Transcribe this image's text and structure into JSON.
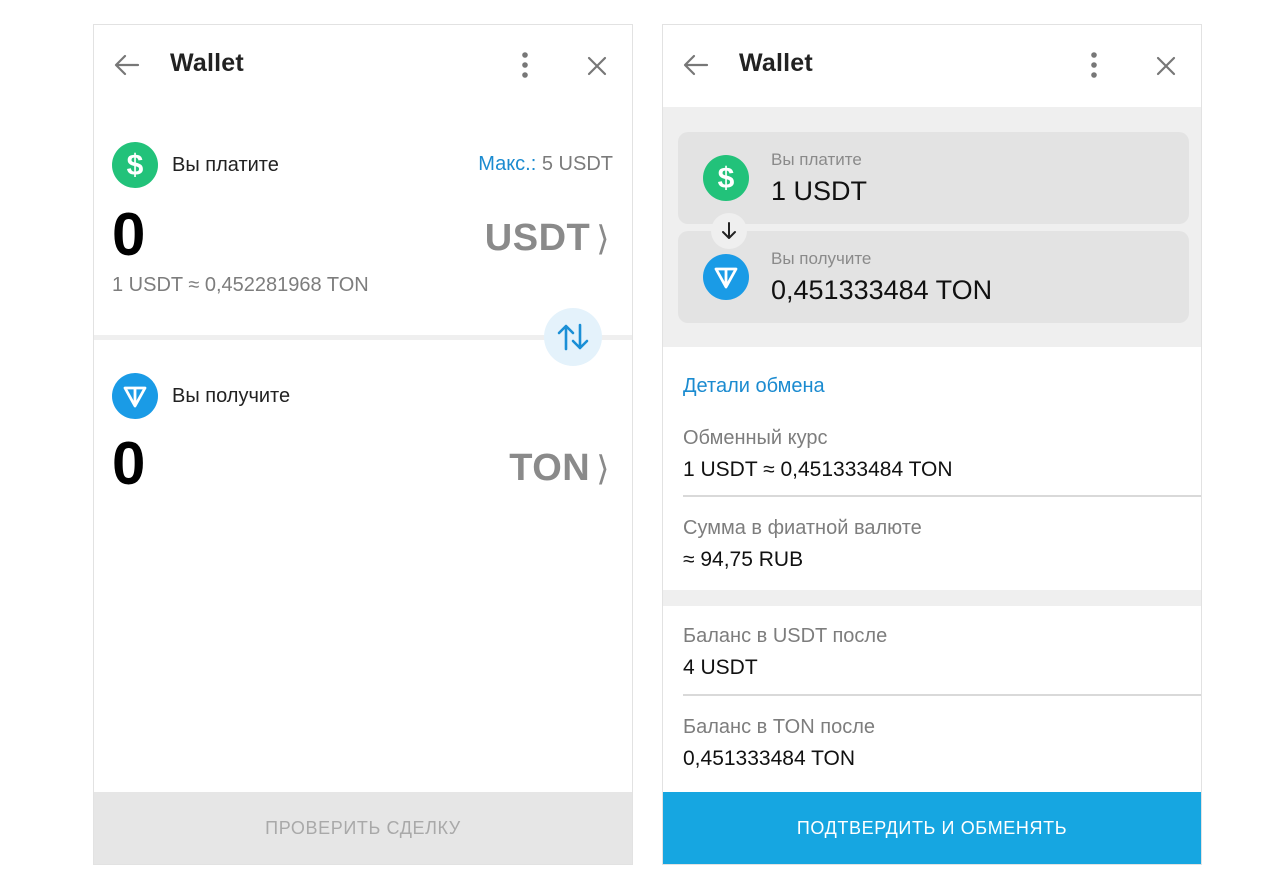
{
  "colors": {
    "accent": "#1b8bd0",
    "primary_button": "#16a6e1",
    "usdt": "#22c27a",
    "ton": "#1a9be6"
  },
  "left": {
    "header": {
      "title": "Wallet",
      "back_icon": "arrow-left-icon",
      "menu_icon": "more-vertical-icon",
      "close_icon": "close-icon"
    },
    "pay": {
      "label": "Вы платите",
      "max_key": "Макс.:",
      "max_value": " 5 USDT",
      "amount": "0",
      "currency": "USDT",
      "rate": "1 USDT ≈ 0,452281968 TON"
    },
    "receive": {
      "label": "Вы получите",
      "amount": "0",
      "currency": "TON"
    },
    "chevron": "⟩",
    "footer_button": "ПРОВЕРИТЬ СДЕЛКУ"
  },
  "right": {
    "header": {
      "title": "Wallet",
      "back_icon": "arrow-left-icon",
      "menu_icon": "more-vertical-icon",
      "close_icon": "close-icon"
    },
    "pay": {
      "label": "Вы платите",
      "value": "1 USDT"
    },
    "receive": {
      "label": "Вы получите",
      "value": "0,451333484 TON"
    },
    "details_title": "Детали обмена",
    "details": [
      {
        "label": "Обменный курс",
        "value": "1 USDT ≈ 0,451333484 TON"
      },
      {
        "label": "Сумма в фиатной валюте",
        "value": "≈ 94,75 RUB"
      },
      {
        "label": "Баланс в USDT после",
        "value": "4 USDT"
      },
      {
        "label": "Баланс в TON после",
        "value": "0,451333484 TON"
      }
    ],
    "footer_button": "ПОДТВЕРДИТЬ И ОБМЕНЯТЬ"
  }
}
